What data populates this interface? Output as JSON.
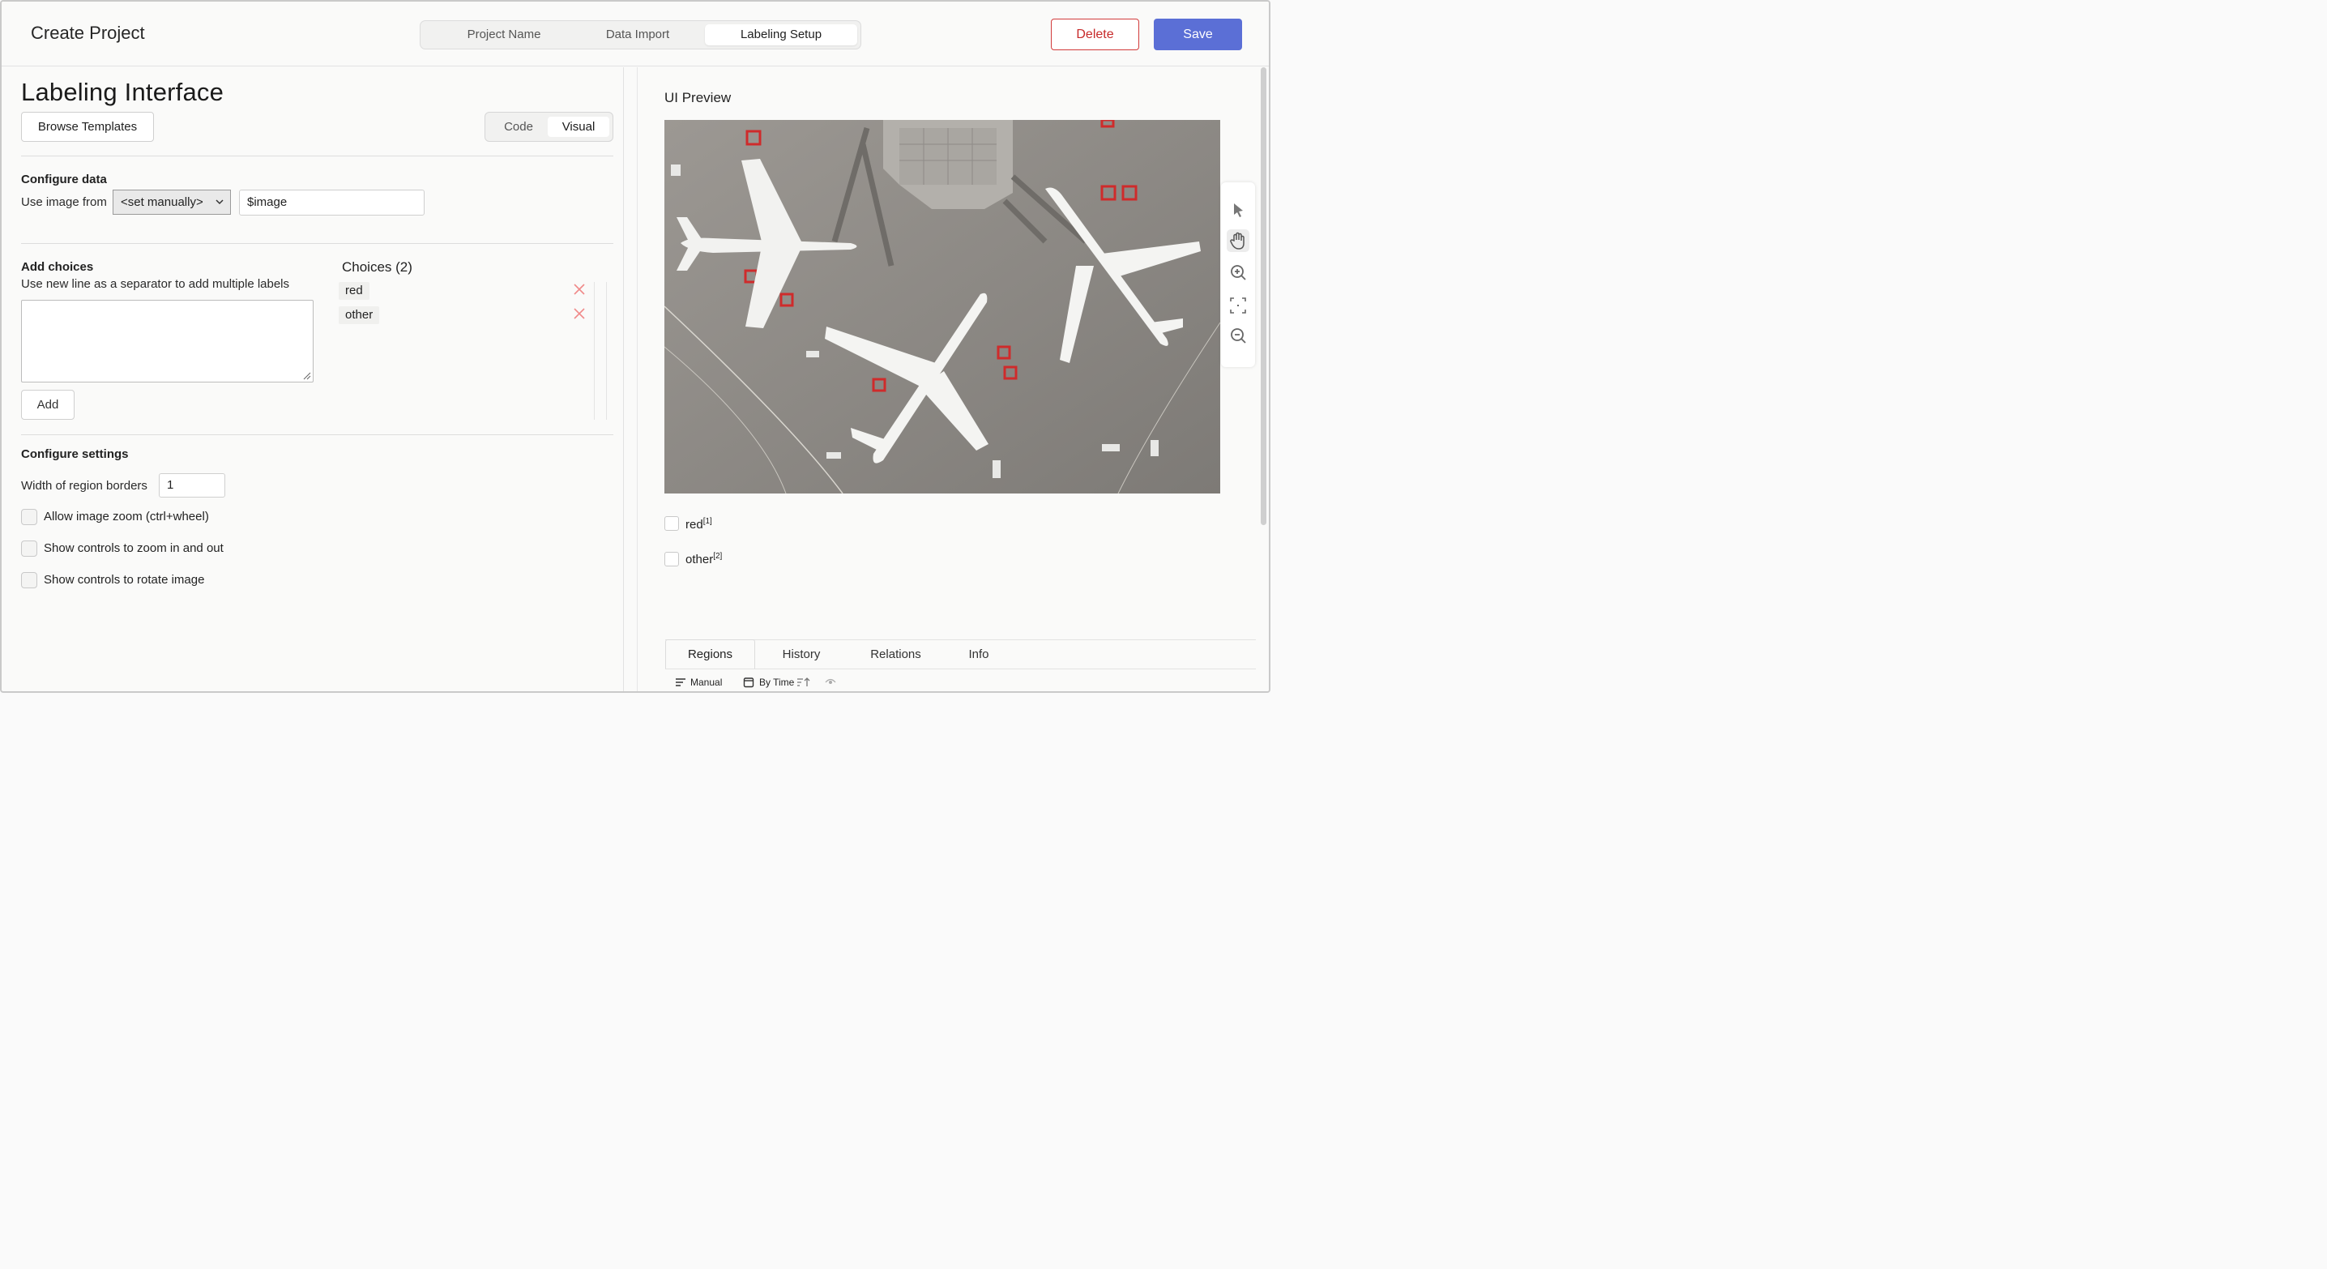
{
  "header": {
    "title": "Create Project",
    "steps": [
      "Project Name",
      "Data Import",
      "Labeling Setup"
    ],
    "active_step": "Labeling Setup",
    "delete_label": "Delete",
    "save_label": "Save"
  },
  "left": {
    "title": "Labeling Interface",
    "browse_label": "Browse Templates",
    "mode": {
      "code": "Code",
      "visual": "Visual",
      "active": "Visual"
    },
    "configure_data": {
      "heading": "Configure data",
      "use_image_from": "Use image from",
      "select_value": "<set manually>",
      "input_value": "$image"
    },
    "add_choices": {
      "heading": "Add choices",
      "hint": "Use new line as a separator to add multiple labels",
      "textarea_value": "",
      "add_label": "Add"
    },
    "choices": {
      "title": "Choices (2)",
      "items": [
        "red",
        "other"
      ]
    },
    "settings": {
      "heading": "Configure settings",
      "width_label": "Width of region borders",
      "width_value": "1",
      "options": [
        "Allow image zoom (ctrl+wheel)",
        "Show controls to zoom in and out",
        "Show controls to rotate image"
      ]
    }
  },
  "right": {
    "title": "UI Preview",
    "choices": [
      {
        "label": "red",
        "hotkey": "[1]"
      },
      {
        "label": "other",
        "hotkey": "[2]"
      }
    ],
    "tabs": [
      "Regions",
      "History",
      "Relations",
      "Info"
    ],
    "active_tab": "Regions",
    "sub": {
      "manual": "Manual",
      "by_time": "By Time"
    }
  },
  "colors": {
    "accent": "#5b6fd6",
    "danger": "#c72a2a",
    "remove_x": "#f08a8a"
  }
}
